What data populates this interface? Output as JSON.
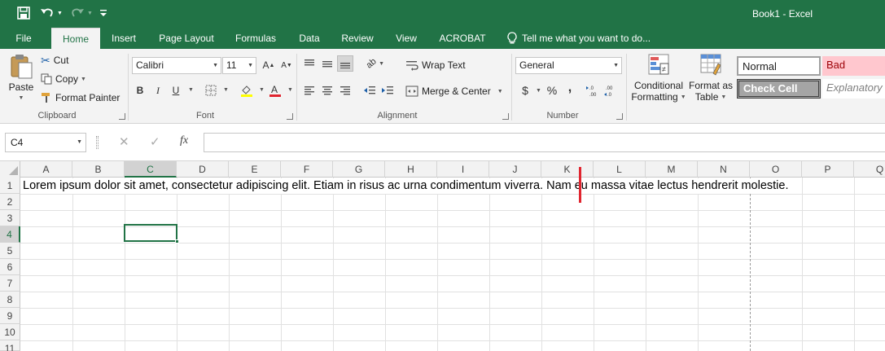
{
  "window": {
    "title": "Book1 - Excel"
  },
  "tabs": [
    {
      "label": "File",
      "active": false
    },
    {
      "label": "Home",
      "active": true
    },
    {
      "label": "Insert",
      "active": false
    },
    {
      "label": "Page Layout",
      "active": false
    },
    {
      "label": "Formulas",
      "active": false
    },
    {
      "label": "Data",
      "active": false
    },
    {
      "label": "Review",
      "active": false
    },
    {
      "label": "View",
      "active": false
    },
    {
      "label": "ACROBAT",
      "active": false
    }
  ],
  "tell_me": "Tell me what you want to do...",
  "clipboard": {
    "paste": "Paste",
    "cut": "Cut",
    "copy": "Copy",
    "format_painter": "Format Painter",
    "label": "Clipboard"
  },
  "font": {
    "name": "Calibri",
    "size": "11",
    "bold": "B",
    "italic": "I",
    "underline": "U",
    "label": "Font"
  },
  "alignment": {
    "wrap_text": "Wrap Text",
    "merge_center": "Merge & Center",
    "label": "Alignment"
  },
  "number": {
    "format": "General",
    "currency": "$",
    "percent": "%",
    "comma": ",",
    "label": "Number"
  },
  "styles_group": {
    "conditional_formatting": [
      "Conditional",
      "Formatting"
    ],
    "format_as_table": [
      "Format as",
      "Table"
    ],
    "normal": "Normal",
    "bad": "Bad",
    "check_cell": "Check Cell",
    "explanatory": "Explanatory"
  },
  "formula_bar": {
    "name_box": "C4",
    "fx": "fx",
    "value": ""
  },
  "sheet": {
    "columns": [
      "A",
      "B",
      "C",
      "D",
      "E",
      "F",
      "G",
      "H",
      "I",
      "J",
      "K",
      "L",
      "M",
      "N",
      "O",
      "P",
      "Q"
    ],
    "rows": [
      "1",
      "2",
      "3",
      "4",
      "5",
      "6",
      "7",
      "8",
      "9",
      "10",
      "11"
    ],
    "selected_cell": "C4",
    "cells": {
      "A1": "Lorem ipsum dolor sit amet, consectetur adipiscing elit. Etiam in risus ac urna condimentum viverra. Nam eu massa vitae lectus hendrerit molestie."
    }
  },
  "colors": {
    "brand": "#217346",
    "annotation_mark": "#e0252f"
  }
}
